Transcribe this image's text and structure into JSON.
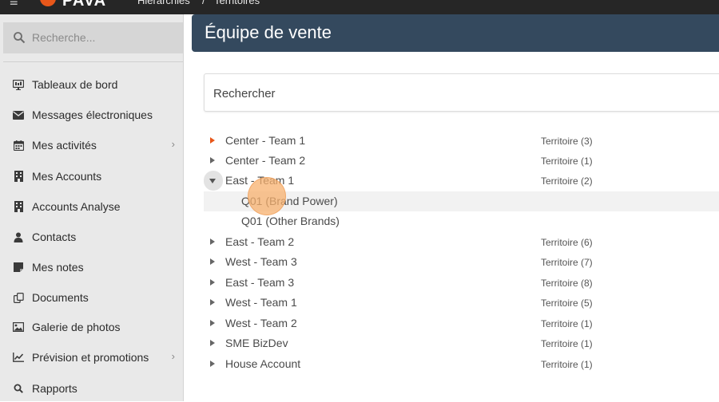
{
  "topbar": {
    "logo": "PAVA",
    "breadcrumb": [
      "Hiérarchies",
      "/",
      "Territoires"
    ]
  },
  "sidebar": {
    "search_placeholder": "Recherche...",
    "items": [
      {
        "label": "Tableaux de bord",
        "icon": "dashboard-icon",
        "has_submenu": false
      },
      {
        "label": "Messages électroniques",
        "icon": "envelope-icon",
        "has_submenu": false
      },
      {
        "label": "Mes activités",
        "icon": "calendar-icon",
        "has_submenu": true
      },
      {
        "label": "Mes Accounts",
        "icon": "building-icon",
        "has_submenu": false
      },
      {
        "label": "Accounts Analyse",
        "icon": "building-icon",
        "has_submenu": false
      },
      {
        "label": "Contacts",
        "icon": "person-icon",
        "has_submenu": false
      },
      {
        "label": "Mes notes",
        "icon": "note-icon",
        "has_submenu": false
      },
      {
        "label": "Documents",
        "icon": "documents-icon",
        "has_submenu": false
      },
      {
        "label": "Galerie de photos",
        "icon": "image-icon",
        "has_submenu": false
      },
      {
        "label": "Prévision et promotions",
        "icon": "chart-line-icon",
        "has_submenu": true
      },
      {
        "label": "Rapports",
        "icon": "search-icon",
        "has_submenu": false
      }
    ]
  },
  "main": {
    "title": "Équipe de vente",
    "search_placeholder": "Rechercher",
    "tree": [
      {
        "name": "Center - Team 1",
        "count": "Territoire (3)",
        "level": 0,
        "state": "collapsed",
        "highlight_arrow": true
      },
      {
        "name": "Center - Team 2",
        "count": "Territoire (1)",
        "level": 0,
        "state": "collapsed"
      },
      {
        "name": "East - Team 1",
        "count": "Territoire (2)",
        "level": 0,
        "state": "expanded"
      },
      {
        "name": "Q01 (Brand Power)",
        "count": "",
        "level": 1,
        "state": "leaf",
        "selected": true
      },
      {
        "name": "Q01 (Other Brands)",
        "count": "",
        "level": 1,
        "state": "leaf"
      },
      {
        "name": "East - Team 2",
        "count": "Territoire (6)",
        "level": 0,
        "state": "collapsed"
      },
      {
        "name": "West - Team 3",
        "count": "Territoire (7)",
        "level": 0,
        "state": "collapsed"
      },
      {
        "name": "East - Team 3",
        "count": "Territoire (8)",
        "level": 0,
        "state": "collapsed"
      },
      {
        "name": "West - Team 1",
        "count": "Territoire (5)",
        "level": 0,
        "state": "collapsed"
      },
      {
        "name": "West - Team 2",
        "count": "Territoire (1)",
        "level": 0,
        "state": "collapsed"
      },
      {
        "name": "SME BizDev",
        "count": "Territoire (1)",
        "level": 0,
        "state": "collapsed"
      },
      {
        "name": "House Account",
        "count": "Territoire (1)",
        "level": 0,
        "state": "collapsed"
      }
    ]
  },
  "colors": {
    "header_bg": "#34495e",
    "accent": "#e8571a",
    "sidebar_bg": "#e9e9e9",
    "click_marker": "#f7b06e"
  }
}
